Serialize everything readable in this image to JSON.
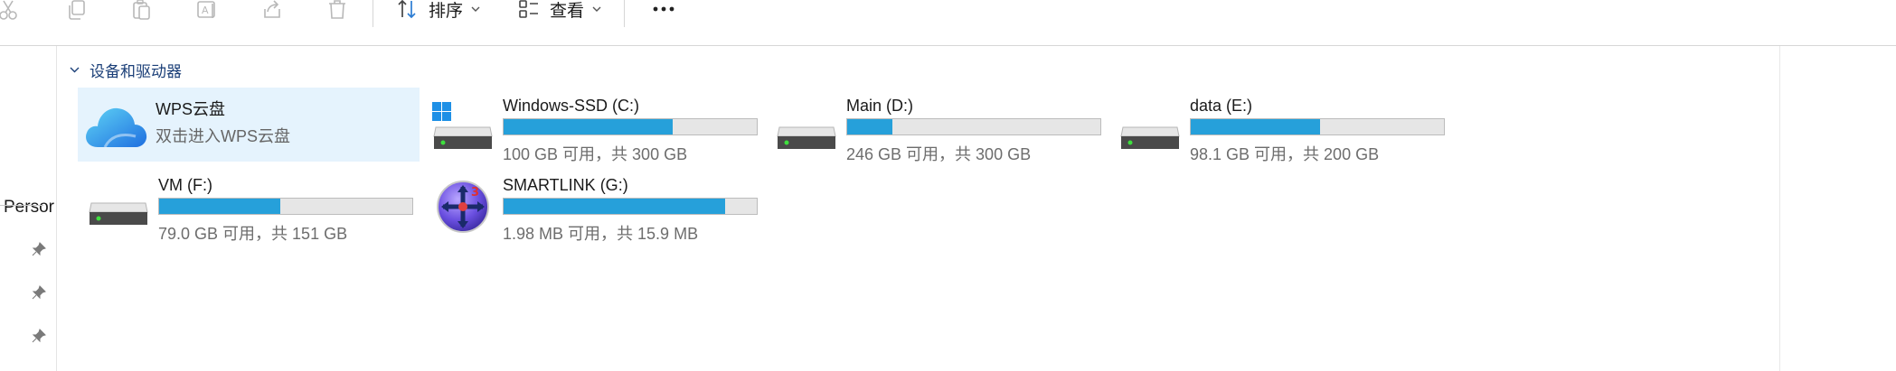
{
  "toolbar": {
    "icons": [
      "cut-icon",
      "copy-icon",
      "paste-icon",
      "rename-icon",
      "share-icon",
      "delete-icon"
    ],
    "sort_label": "排序",
    "view_label": "查看",
    "more_label": "···"
  },
  "nav": {
    "partial_label": "Persor"
  },
  "group": {
    "title": "设备和驱动器"
  },
  "drives": [
    {
      "name": "WPS云盘",
      "subtitle": "双击进入WPS云盘",
      "icon": "wps-cloud-icon",
      "used_fraction": null
    },
    {
      "name": "Windows-SSD (C:)",
      "free": "100 GB 可用，共 300 GB",
      "icon": "windows-drive-icon",
      "used_fraction": 0.667
    },
    {
      "name": "Main (D:)",
      "free": "246 GB 可用，共 300 GB",
      "icon": "hard-drive-icon",
      "used_fraction": 0.18
    },
    {
      "name": "data (E:)",
      "free": "98.1 GB 可用，共 200 GB",
      "icon": "hard-drive-icon",
      "used_fraction": 0.51
    },
    {
      "name": "VM (F:)",
      "free": "79.0 GB 可用，共 151 GB",
      "icon": "hard-drive-icon",
      "used_fraction": 0.477
    },
    {
      "name": "SMARTLINK (G:)",
      "free": "1.98 MB 可用，共 15.9 MB",
      "icon": "smartlink-icon",
      "used_fraction": 0.875
    }
  ],
  "colors": {
    "bar_fill": "#26a0da",
    "bar_track": "#e6e6e6",
    "selected_tile": "#e5f3fd",
    "group_header": "#1b3f78"
  }
}
